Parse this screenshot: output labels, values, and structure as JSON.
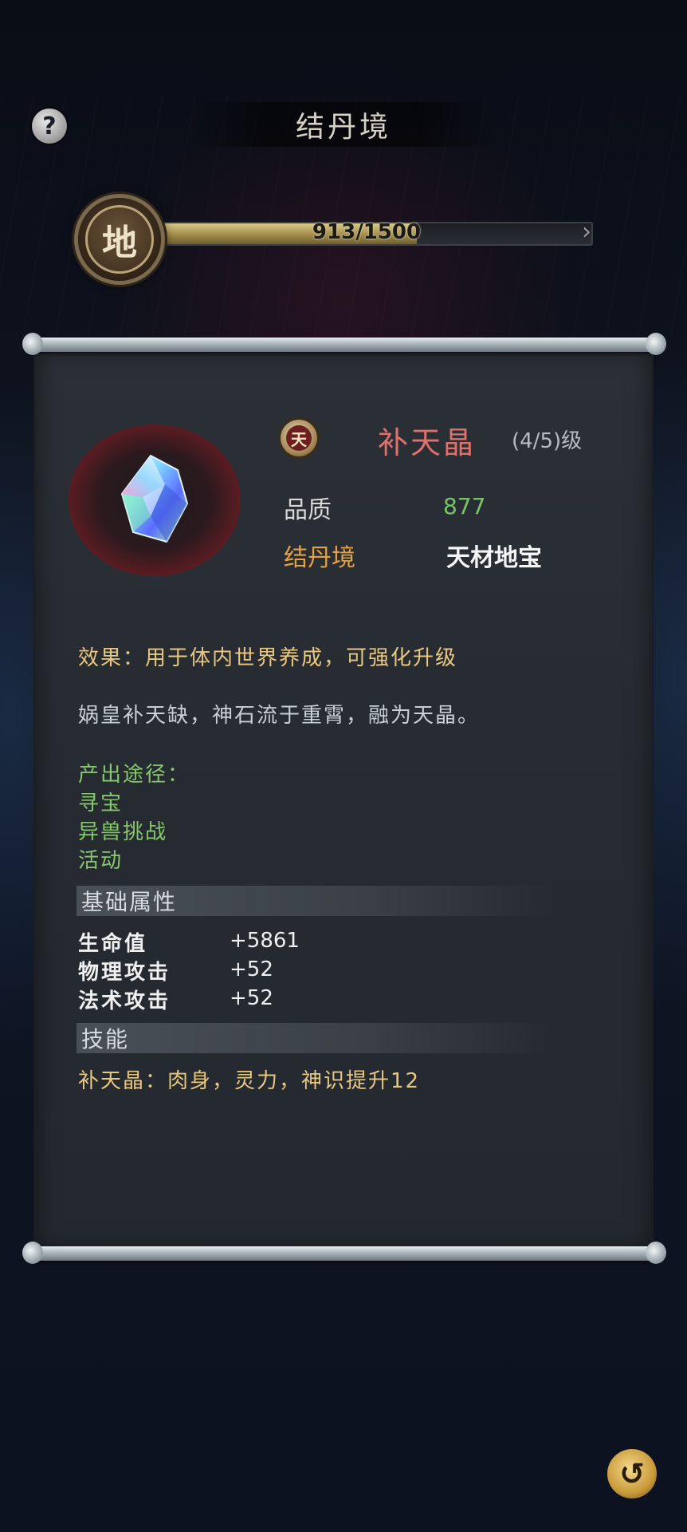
{
  "header": {
    "title": "结丹境",
    "help_icon": "question-icon",
    "help_glyph": "?"
  },
  "progress": {
    "tier_badge": "地",
    "current": 913,
    "max": 1500,
    "text": "913/1500",
    "arrow_glyph": "›"
  },
  "item": {
    "grade_badge": "天",
    "name": "补天晶",
    "level_text": "(4/5)级",
    "quality_label": "品质",
    "quality_value": "877",
    "realm_label": "结丹境",
    "category": "天材地宝",
    "effect": "效果：用于体内世界养成，可强化升级",
    "description": "娲皇补天缺，神石流于重霄，融为天晶。",
    "sources_title": "产出途径：",
    "sources": [
      "寻宝",
      "异兽挑战",
      "活动"
    ]
  },
  "base_attributes": {
    "title": "基础属性",
    "rows": [
      {
        "label": "生命值",
        "value": "+5861"
      },
      {
        "label": "物理攻击",
        "value": "+52"
      },
      {
        "label": "法术攻击",
        "value": "+52"
      }
    ]
  },
  "skills": {
    "title": "技能",
    "text": "补天晶：肉身，灵力，神识提升12"
  },
  "footer": {
    "return_icon": "return-icon",
    "return_glyph": "↺"
  },
  "colors": {
    "item_name": "#e0706a",
    "quality_value": "#7bc36a",
    "realm": "#e4a146",
    "effect": "#e8c880",
    "sources": "#86c86c"
  }
}
